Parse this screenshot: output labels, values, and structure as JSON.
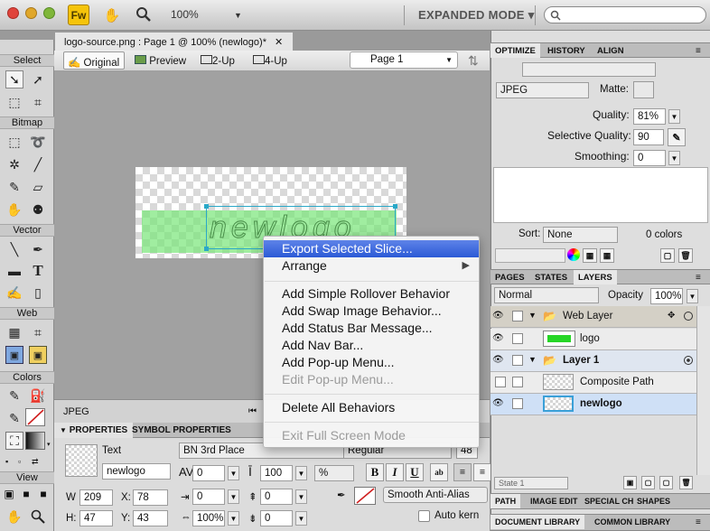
{
  "toolbar": {
    "zoom": "100%",
    "mode": "EXPANDED MODE",
    "search_placeholder": ""
  },
  "tools": {
    "sections": [
      "Select",
      "Bitmap",
      "Vector",
      "Web",
      "Colors",
      "View"
    ]
  },
  "document": {
    "tab_title": "logo-source.png : Page 1 @ 100% (newlogo)*",
    "views": [
      "Original",
      "Preview",
      "2-Up",
      "4-Up"
    ],
    "page": "Page 1",
    "canvas_text": "newlogo",
    "status_format": "JPEG"
  },
  "properties": {
    "tabs": [
      "PROPERTIES",
      "SYMBOL PROPERTIES"
    ],
    "object_type": "Text",
    "object_name": "newlogo",
    "font": "BN 3rd Place",
    "style": "Regular",
    "size": "48",
    "kerning": "0",
    "leading": "100",
    "leading_unit": "%",
    "indent": "0",
    "space_before": "0",
    "space_after": "0",
    "horizontal_scale": "100%",
    "baseline_shift": "0",
    "w_label": "W",
    "w": "209",
    "h_label": "H:",
    "h": "47",
    "x_label": "X:",
    "x": "78",
    "y_label": "Y:",
    "y": "43",
    "bold": "B",
    "italic": "I",
    "underline": "U",
    "antialias": "Smooth Anti-Alias",
    "auto_kern": "Auto kern"
  },
  "optimize": {
    "tabs": [
      "OPTIMIZE",
      "HISTORY",
      "ALIGN"
    ],
    "format": "JPEG",
    "matte_label": "Matte:",
    "quality_label": "Quality:",
    "quality": "81%",
    "selective_quality_label": "Selective Quality:",
    "selective_quality": "90",
    "smoothing_label": "Smoothing:",
    "smoothing": "0",
    "sort_label": "Sort:",
    "sort": "None",
    "colors": "0 colors"
  },
  "layers": {
    "tabs": [
      "PAGES",
      "STATES",
      "LAYERS"
    ],
    "blend": "Normal",
    "opacity_label": "Opacity",
    "opacity": "100%",
    "rows": [
      {
        "name": "Web Layer"
      },
      {
        "name": "logo"
      },
      {
        "name": "Layer 1"
      },
      {
        "name": "Composite Path"
      },
      {
        "name": "newlogo"
      }
    ],
    "state": "State 1"
  },
  "bottom_tabs": {
    "row1": [
      "PATH",
      "IMAGE EDIT",
      "SPECIAL CH",
      "SHAPES"
    ],
    "row2": [
      "DOCUMENT LIBRARY",
      "COMMON LIBRARY"
    ]
  },
  "context_menu": {
    "items": [
      {
        "label": "Export Selected Slice..."
      },
      {
        "label": "Arrange"
      },
      {
        "label": "Add Simple Rollover Behavior"
      },
      {
        "label": "Add Swap Image Behavior..."
      },
      {
        "label": "Add Status Bar Message..."
      },
      {
        "label": "Add Nav Bar..."
      },
      {
        "label": "Add Pop-up Menu..."
      },
      {
        "label": "Edit Pop-up Menu..."
      },
      {
        "label": "Delete All Behaviors"
      },
      {
        "label": "Exit Full Screen Mode"
      }
    ]
  },
  "colors": {
    "accent": "#2b5ad6",
    "fw_logo": "#f5c40a",
    "slice_green": "#78e678",
    "selection_row": "#d3e3f8"
  }
}
